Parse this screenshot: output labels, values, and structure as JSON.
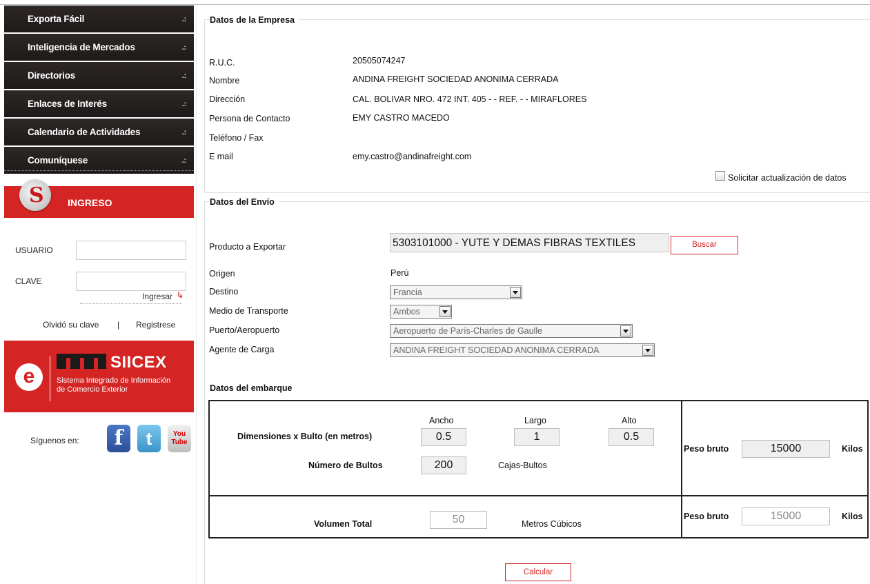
{
  "menu": [
    {
      "label": "Exporta Fácil"
    },
    {
      "label": "Inteligencia de Mercados"
    },
    {
      "label": "Directorios"
    },
    {
      "label": "Enlaces de Interés"
    },
    {
      "label": "Calendario de Actividades"
    },
    {
      "label": "Comuníquese"
    }
  ],
  "menu_dots": ".:",
  "login": {
    "header": "INGRESO",
    "usuario_label": "USUARIO",
    "clave_label": "CLAVE",
    "ingresar_label": "Ingresar",
    "forgot_label": "Olvidó su clave",
    "separator": "|",
    "register_label": "Registrese"
  },
  "siicex": {
    "title": "SIICEX",
    "subtitle_line1": "Sistema Integrado de Información",
    "subtitle_line2": "de Comercio Exterior"
  },
  "social": {
    "label": "Síguenos en:",
    "facebook": "f",
    "twitter": "t",
    "youtube_top": "You",
    "youtube_bottom": "Tube"
  },
  "empresa": {
    "title": "Datos de la Empresa",
    "fields": [
      {
        "label": "R.U.C.",
        "value": "20505074247"
      },
      {
        "label": "Nombre",
        "value": "ANDINA FREIGHT SOCIEDAD ANONIMA CERRADA"
      },
      {
        "label": "Dirección",
        "value": "CAL. BOLIVAR NRO. 472 INT. 405 - - REF. - - MIRAFLORES"
      },
      {
        "label": "Persona de Contacto",
        "value": "EMY CASTRO MACEDO"
      },
      {
        "label": "Teléfono / Fax",
        "value": ""
      },
      {
        "label": "E mail",
        "value": "emy.castro@andinafreight.com"
      }
    ],
    "update_checkbox_label": "Solicitar actualización de datos"
  },
  "envio": {
    "title": "Datos del Envío",
    "producto_label": "Producto a Exportar",
    "producto_value": "5303101000 - YUTE Y DEMAS FIBRAS TEXTILES",
    "buscar_label": "Buscar",
    "origen_label": "Origen",
    "origen_value": "Perú",
    "destino_label": "Destino",
    "destino_value": "Francia",
    "medio_label": "Medio de Transporte",
    "medio_value": "Ambos",
    "puerto_label": "Puerto/Aeropuerto",
    "puerto_value": "Aeropuerto de París-Charles de Gaulle",
    "agente_label": "Agente de Carga",
    "agente_value": "ANDINA FREIGHT SOCIEDAD ANONIMA CERRADA"
  },
  "embarque": {
    "title": "Datos del embarque",
    "ancho_label": "Ancho",
    "largo_label": "Largo",
    "alto_label": "Alto",
    "dimensiones_label": "Dimensiones x Bulto (en metros)",
    "ancho_value": "0.5",
    "largo_value": "1",
    "alto_value": "0.5",
    "bultos_label": "Número de Bultos",
    "bultos_value": "200",
    "bultos_unit": "Cajas-Bultos",
    "peso_label": "Peso bruto",
    "peso_value": "15000",
    "peso_unit": "Kilos",
    "volumen_label": "Volumen Total",
    "volumen_value": "50",
    "volumen_unit": "Metros Cúbicos",
    "peso2_label": "Peso bruto",
    "peso2_value": "15000",
    "peso2_unit": "Kilos"
  },
  "calcular_label": "Calcular",
  "colors": {
    "accent_red": "#d42424",
    "menu_dark": "#2d2826"
  }
}
